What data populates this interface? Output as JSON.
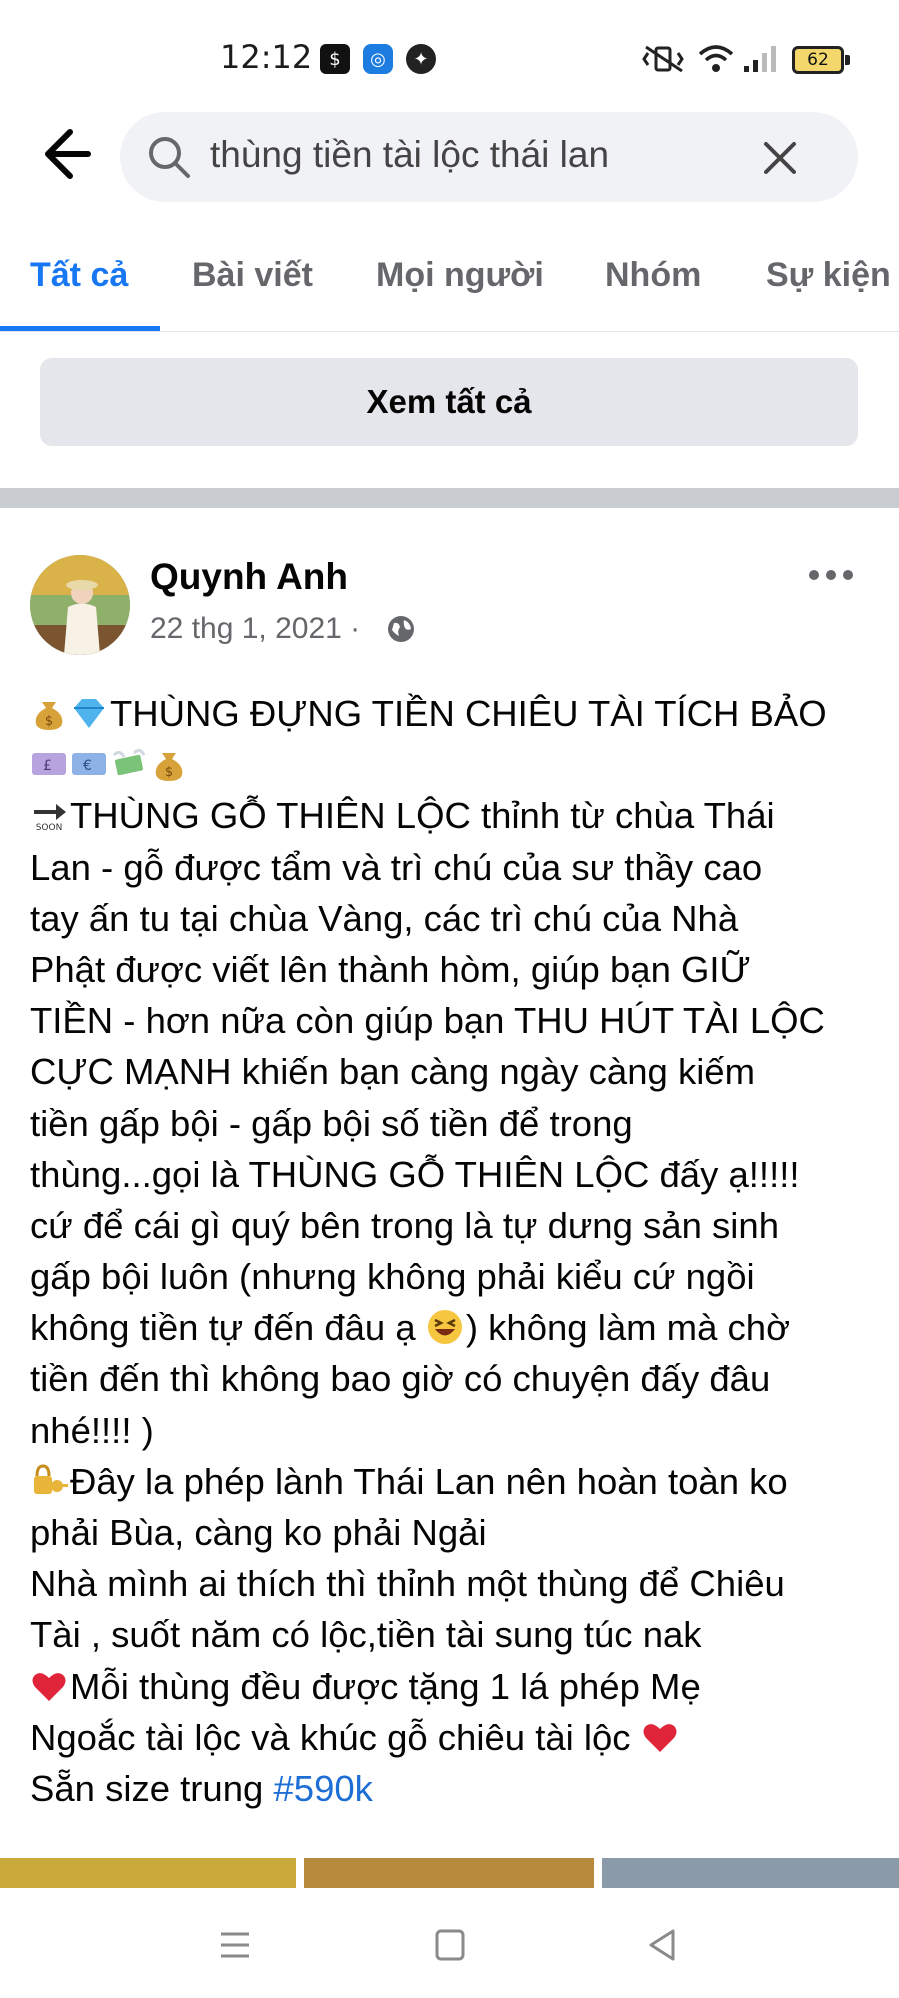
{
  "status_bar": {
    "time": "12:12",
    "battery": "62"
  },
  "search": {
    "query": "thùng tiền tài lộc thái lan"
  },
  "tabs": [
    {
      "label": "Tất cả",
      "active": true
    },
    {
      "label": "Bài viết",
      "active": false
    },
    {
      "label": "Mọi người",
      "active": false
    },
    {
      "label": "Nhóm",
      "active": false
    },
    {
      "label": "Sự kiện",
      "active": false
    }
  ],
  "see_all_label": "Xem tất cả",
  "post": {
    "author": "Quynh Anh",
    "date": "22 thg 1, 2021 ·",
    "lines": [
      "THÙNG ĐỰNG TIỀN CHIÊU TÀI TÍCH BẢO",
      "",
      "THÙNG GỖ THIÊN LỘC thỉnh từ chùa Thái",
      "Lan - gỗ được tẩm và trì chú của sư thầy cao",
      "tay ấn tu tại chùa Vàng, các trì chú của Nhà",
      "Phật được viết lên thành hòm, giúp bạn GIỮ",
      "TIỀN - hơn nữa còn giúp bạn THU HÚT TÀI LỘC",
      "CỰC MẠNH khiến bạn càng ngày càng kiếm",
      "tiền gấp bội - gấp bội số tiền để trong",
      "thùng...gọi là THÙNG GỖ THIÊN LỘC đấy ạ!!!!!",
      "cứ để cái gì quý bên trong là tự dưng sản sinh",
      "gấp bội luôn (nhưng không phải kiểu cứ ngồi",
      "không tiền tự đến đâu ạ",
      ") không làm mà chờ",
      "tiền đến thì không bao giờ có chuyện đấy đâu",
      "nhé!!!! )",
      "Đây la phép lành Thái Lan nên hoàn toàn ko",
      "phải Bùa, càng ko phải Ngải",
      "Nhà mình ai thích thì thỉnh một thùng để Chiêu",
      "Tài , suốt năm có lộc,tiền tài sung túc nak",
      "Mỗi thùng đều được tặng 1 lá phép Mẹ",
      " Ngoắc tài lộc và khúc gỗ chiêu tài lộc ",
      "Sẵn size trung ",
      "#590k"
    ]
  },
  "colors": {
    "accent": "#1877f2",
    "hashtag": "#1d6fd6",
    "muted": "#65676b"
  }
}
